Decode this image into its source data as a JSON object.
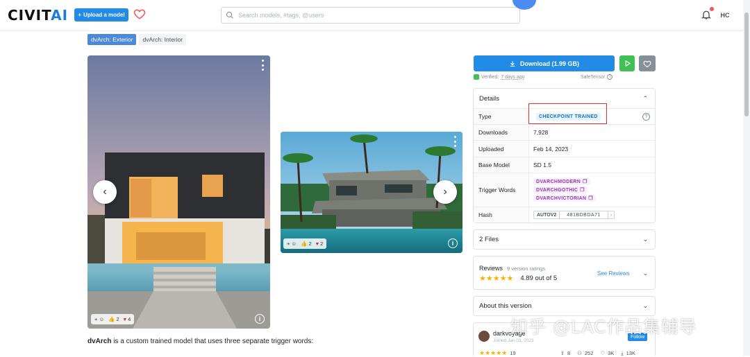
{
  "header": {
    "logo_text": "CIVIT",
    "logo_ai": "AI",
    "upload_label": "Upload a model",
    "search_placeholder": "Search models, #tags, @users",
    "user_initials": "HC"
  },
  "version_tabs": [
    {
      "label": "dvArch: Exterior",
      "active": true
    },
    {
      "label": "dvArch: Interior",
      "active": false
    }
  ],
  "gallery": {
    "image1": {
      "reaction_likes": "2",
      "reaction_hearts": "4"
    },
    "image2": {
      "reaction_likes": "2",
      "reaction_hearts": "2"
    }
  },
  "description": {
    "model_name": "dvArch",
    "text": " is a custom trained model that uses three separate trigger words:"
  },
  "sidebar": {
    "download_label": "Download (1.99 GB)",
    "verified_prefix": "Verified:",
    "verified_date": "7 days ago",
    "safetensor_label": "SafeTensor",
    "details_title": "Details",
    "details": {
      "type_label": "Type",
      "type_value": "CHECKPOINT TRAINED",
      "downloads_label": "Downloads",
      "downloads_value": "7,928",
      "uploaded_label": "Uploaded",
      "uploaded_value": "Feb 14, 2023",
      "base_model_label": "Base Model",
      "base_model_value": "SD 1.5",
      "trigger_label": "Trigger Words",
      "trigger_words": [
        "DVARCHMODERN",
        "DVARCHGOTHIC",
        "DVARCHVICTORIAN"
      ],
      "hash_label": "Hash",
      "hash_type": "AUTOV2",
      "hash_value": "481BDBDA71"
    },
    "files_label": "2 Files",
    "reviews": {
      "title": "Reviews",
      "count": "9 version ratings",
      "rating": "4.89 out of 5",
      "see_label": "See Reviews"
    },
    "about_label": "About this version",
    "creator": {
      "name": "darkvoyage",
      "joined": "Joined Jan 03, 2023",
      "follow_label": "Follow",
      "reviews_count": "19",
      "uploads": "8",
      "followers": "252",
      "likes": "3K",
      "downloads": "13K"
    }
  },
  "watermark": "知乎 @LAC作品集辅导",
  "colors": {
    "primary": "#228be6",
    "play": "#40c057",
    "trigger": "#9c36b5",
    "highlight_box": "#e03131"
  }
}
